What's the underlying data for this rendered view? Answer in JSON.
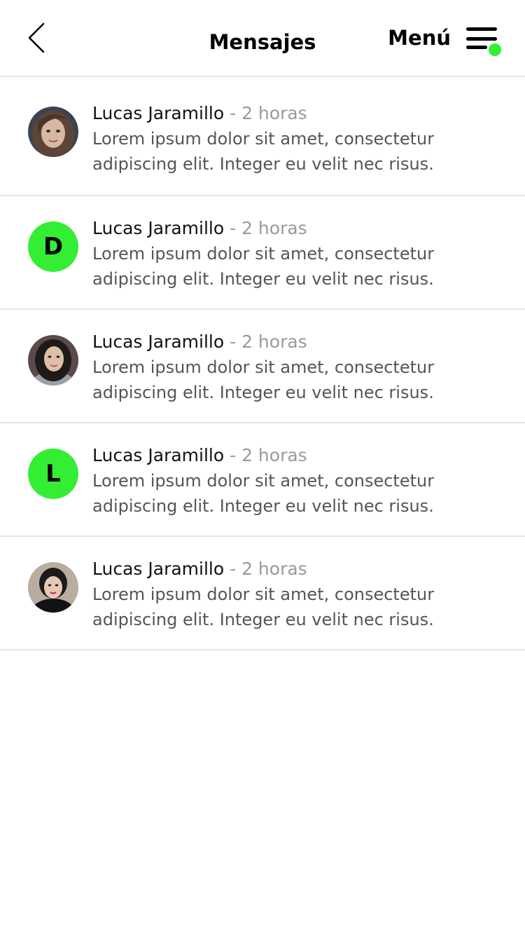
{
  "header": {
    "title": "Mensajes",
    "menu_label": "Menú"
  },
  "icons": {
    "back": "chevron-left-icon",
    "menu": "hamburger-menu-icon",
    "notification_dot": "notification-dot-icon"
  },
  "colors": {
    "accent": "#33ee33",
    "divider": "#e6e6e6",
    "time_text": "#9a9a9a",
    "body_text": "#555555"
  },
  "messages": [
    {
      "avatar_type": "photo",
      "name": "Lucas Jaramillo",
      "time": " - 2 horas",
      "line1": "Lorem ipsum dolor sit amet, consectetur",
      "line2": "adipiscing elit. Integer eu velit nec risus."
    },
    {
      "avatar_type": "letter",
      "avatar_letter": "D",
      "name": "Lucas Jaramillo",
      "time": " - 2 horas",
      "line1": "Lorem ipsum dolor sit amet, consectetur",
      "line2": "adipiscing elit. Integer eu velit nec risus."
    },
    {
      "avatar_type": "photo",
      "name": "Lucas Jaramillo",
      "time": " - 2 horas",
      "line1": "Lorem ipsum dolor sit amet, consectetur",
      "line2": "adipiscing elit. Integer eu velit nec risus."
    },
    {
      "avatar_type": "letter",
      "avatar_letter": "L",
      "name": "Lucas Jaramillo",
      "time": " - 2 horas",
      "line1": "Lorem ipsum dolor sit amet, consectetur",
      "line2": "adipiscing elit. Integer eu velit nec risus."
    },
    {
      "avatar_type": "photo",
      "name": "Lucas Jaramillo",
      "time": " - 2 horas",
      "line1": "Lorem ipsum dolor sit amet, consectetur",
      "line2": "adipiscing elit. Integer eu velit nec risus."
    }
  ]
}
